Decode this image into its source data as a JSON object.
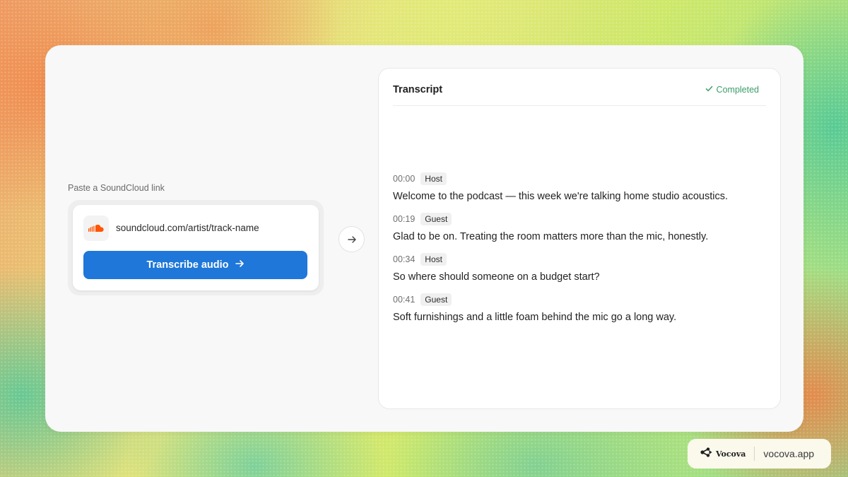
{
  "colors": {
    "accent": "#1e77d9",
    "status": "#3c9d6a",
    "soundcloud": "#ff5500"
  },
  "input": {
    "label": "Paste a SoundCloud link",
    "url": "soundcloud.com/artist/track-name",
    "icon": "soundcloud-icon",
    "button_label": "Transcribe audio",
    "button_icon": "arrow-right-icon"
  },
  "connector": {
    "icon": "arrow-right-icon"
  },
  "transcript": {
    "title": "Transcript",
    "status": "Completed",
    "status_icon": "check-icon",
    "entries": [
      {
        "time": "00:00",
        "speaker": "Host",
        "text": "Welcome to the podcast — this week we're talking home studio acoustics."
      },
      {
        "time": "00:19",
        "speaker": "Guest",
        "text": "Glad to be on. Treating the room matters more than the mic, honestly."
      },
      {
        "time": "00:34",
        "speaker": "Host",
        "text": "So where should someone on a budget start?"
      },
      {
        "time": "00:41",
        "speaker": "Guest",
        "text": "Soft furnishings and a little foam behind the mic go a long way."
      }
    ]
  },
  "branding": {
    "name": "Vocova",
    "url": "vocova.app",
    "icon": "vocova-logo-icon"
  }
}
